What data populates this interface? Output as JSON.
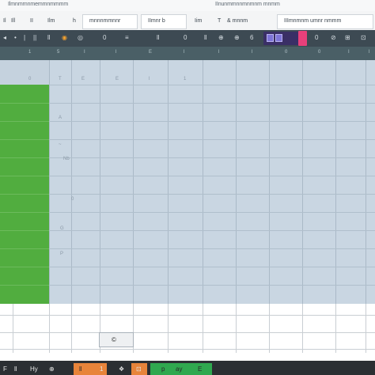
{
  "titlebar": {
    "left_text": "Ilmnmrnnmemmnmmmm",
    "right_text": "IInunmmnnmnmnm mnmm"
  },
  "menubar": {
    "items": [
      "Il",
      "Ill",
      "II",
      "Ilm",
      "h",
      "mnnnmmnnr",
      "IImnr b",
      "Iim",
      "T",
      "& mnnm",
      "IIImnmnm umnr nmmm"
    ]
  },
  "toolbar": {
    "icons": [
      "◂",
      "•",
      "|",
      "||",
      "ll",
      "◉",
      "◎",
      "0",
      "≡",
      "ll",
      "0",
      "ll",
      "⊕",
      "⊕",
      "6",
      "0",
      "⊘",
      "⊞",
      "⊡"
    ],
    "accent_orange": "#f0a030",
    "group_color": "#3a2f66",
    "pink_color": "#e8407a"
  },
  "column_headers": [
    "1",
    "5",
    "I",
    "l",
    "E",
    "l",
    "l",
    "l",
    "0",
    "0",
    "I",
    "l"
  ],
  "row_labels": {
    "header_row": [
      "0",
      "T",
      "E",
      "E",
      "l",
      "1"
    ],
    "left_marks": [
      "A",
      "~",
      "Nb",
      "0",
      "P",
      "G"
    ]
  },
  "zoom": {
    "label": "©"
  },
  "taskbar": {
    "items": [
      "F",
      "ll",
      "Hy",
      "⊕",
      "ll",
      "1",
      "❖",
      "⊡",
      "p",
      "ay",
      "E"
    ]
  },
  "colors": {
    "selection_fill": "#c9d6e2",
    "green_column": "#51ad3f",
    "header_bar": "#4a5f66",
    "toolbar_bg": "#3d4a53"
  }
}
